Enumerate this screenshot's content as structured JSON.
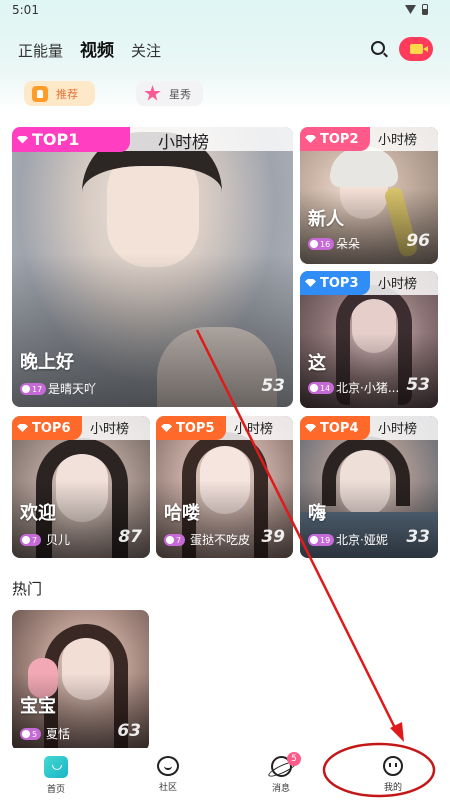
{
  "status": {
    "time": "5:01"
  },
  "top_nav": {
    "tabs": [
      "正能量",
      "视频",
      "关注"
    ]
  },
  "chips": {
    "recommend": "推荐",
    "star_show": "星秀"
  },
  "accent": {
    "recommend_bg": "#fde9c7",
    "live_button": "#ff3b5c",
    "badge": "#c56ad6",
    "annotation": "#e01a1a"
  },
  "cards": [
    {
      "rank": "TOP1",
      "board": "小时榜",
      "title": "晚上好",
      "level": "17",
      "host": "是晴天吖",
      "viewers": "53",
      "tag_color": "#ff3ec2"
    },
    {
      "rank": "TOP2",
      "board": "小时榜",
      "title": "新人",
      "level": "16",
      "host": "朵朵",
      "viewers": "96",
      "tag_color": "#ff5a8a"
    },
    {
      "rank": "TOP3",
      "board": "小时榜",
      "title": "这",
      "level": "14",
      "host": "北京·小猪...",
      "viewers": "53",
      "tag_color": "#2f8df5"
    },
    {
      "rank": "TOP6",
      "board": "小时榜",
      "title": "欢迎",
      "level": "7",
      "host": "贝儿",
      "viewers": "87",
      "tag_color": "#ff6a2a"
    },
    {
      "rank": "TOP5",
      "board": "小时榜",
      "title": "哈喽",
      "level": "7",
      "host": "蛋挞不吃皮",
      "viewers": "39",
      "tag_color": "#ff6a2a"
    },
    {
      "rank": "TOP4",
      "board": "小时榜",
      "title": "嗨",
      "level": "19",
      "host": "北京·娅妮",
      "viewers": "33",
      "tag_color": "#ff6a2a"
    }
  ],
  "hot_section": {
    "title": "热门",
    "card": {
      "title": "宝宝",
      "level": "5",
      "host": "夏恬",
      "viewers": "63"
    }
  },
  "bottom_nav": {
    "home": "首页",
    "community": "社区",
    "messages": "消息",
    "messages_badge": "5",
    "mine": "我的"
  }
}
